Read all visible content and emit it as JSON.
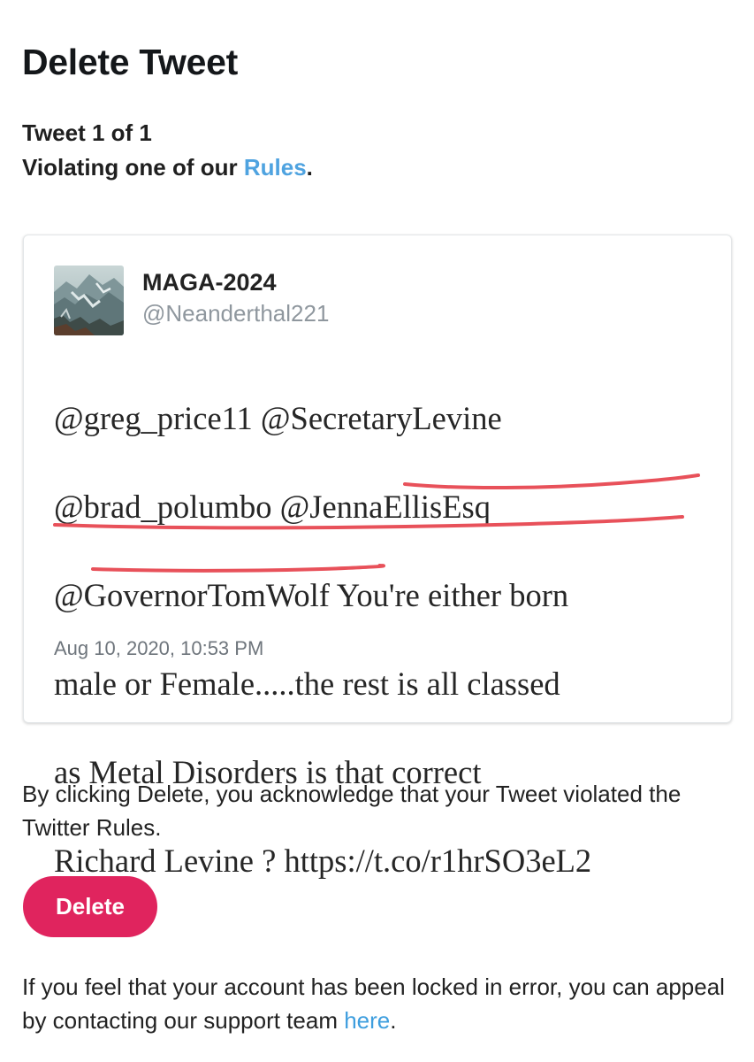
{
  "page": {
    "title": "Delete Tweet",
    "counter": "Tweet 1 of 1",
    "violation_prefix": "Violating one of our ",
    "rules_link": "Rules",
    "violation_suffix": "."
  },
  "tweet": {
    "display_name": "MAGA-2024",
    "handle": "@Neanderthal221",
    "text_lines": [
      "@greg_price11 @SecretaryLevine",
      "@brad_polumbo @JennaEllisEsq",
      "@GovernorTomWolf You're either born",
      "male or Female.....the rest is all classed",
      "as Metal Disorders is that correct",
      "Richard Levine ? https://t.co/r1hrSO3eL2"
    ],
    "timestamp": "Aug 10, 2020, 10:53 PM",
    "annotation_color": "#e8515a"
  },
  "acknowledgement": "By clicking Delete, you acknowledge that your Tweet violated the Twitter Rules.",
  "delete_button": "Delete",
  "appeal": {
    "prefix": "If you feel that your account has been locked in error, you can appeal by contacting our support team ",
    "link": "here",
    "suffix": "."
  },
  "colors": {
    "link": "#4fa3e0",
    "delete_button": "#e0245e"
  }
}
